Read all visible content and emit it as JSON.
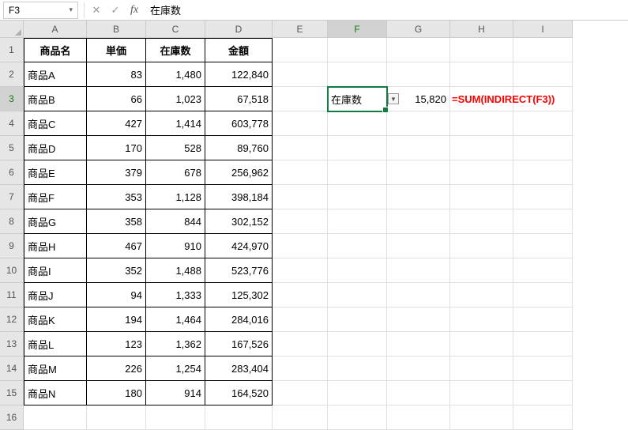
{
  "name_box": "F3",
  "formula_bar": "在庫数",
  "columns": [
    "A",
    "B",
    "C",
    "D",
    "E",
    "F",
    "G",
    "H",
    "I"
  ],
  "active_col": "F",
  "active_row": 3,
  "headers": {
    "A": "商品名",
    "B": "単価",
    "C": "在庫数",
    "D": "金額"
  },
  "rows": [
    {
      "n": "商品A",
      "p": "83",
      "s": "1,480",
      "a": "122,840"
    },
    {
      "n": "商品B",
      "p": "66",
      "s": "1,023",
      "a": "67,518"
    },
    {
      "n": "商品C",
      "p": "427",
      "s": "1,414",
      "a": "603,778"
    },
    {
      "n": "商品D",
      "p": "170",
      "s": "528",
      "a": "89,760"
    },
    {
      "n": "商品E",
      "p": "379",
      "s": "678",
      "a": "256,962"
    },
    {
      "n": "商品F",
      "p": "353",
      "s": "1,128",
      "a": "398,184"
    },
    {
      "n": "商品G",
      "p": "358",
      "s": "844",
      "a": "302,152"
    },
    {
      "n": "商品H",
      "p": "467",
      "s": "910",
      "a": "424,970"
    },
    {
      "n": "商品I",
      "p": "352",
      "s": "1,488",
      "a": "523,776"
    },
    {
      "n": "商品J",
      "p": "94",
      "s": "1,333",
      "a": "125,302"
    },
    {
      "n": "商品K",
      "p": "194",
      "s": "1,464",
      "a": "284,016"
    },
    {
      "n": "商品L",
      "p": "123",
      "s": "1,362",
      "a": "167,526"
    },
    {
      "n": "商品M",
      "p": "226",
      "s": "1,254",
      "a": "283,404"
    },
    {
      "n": "商品N",
      "p": "180",
      "s": "914",
      "a": "164,520"
    }
  ],
  "F3_value": "在庫数",
  "G3_value": "15,820",
  "H3_formula": "=SUM(INDIRECT(F3))",
  "row_count": 16
}
